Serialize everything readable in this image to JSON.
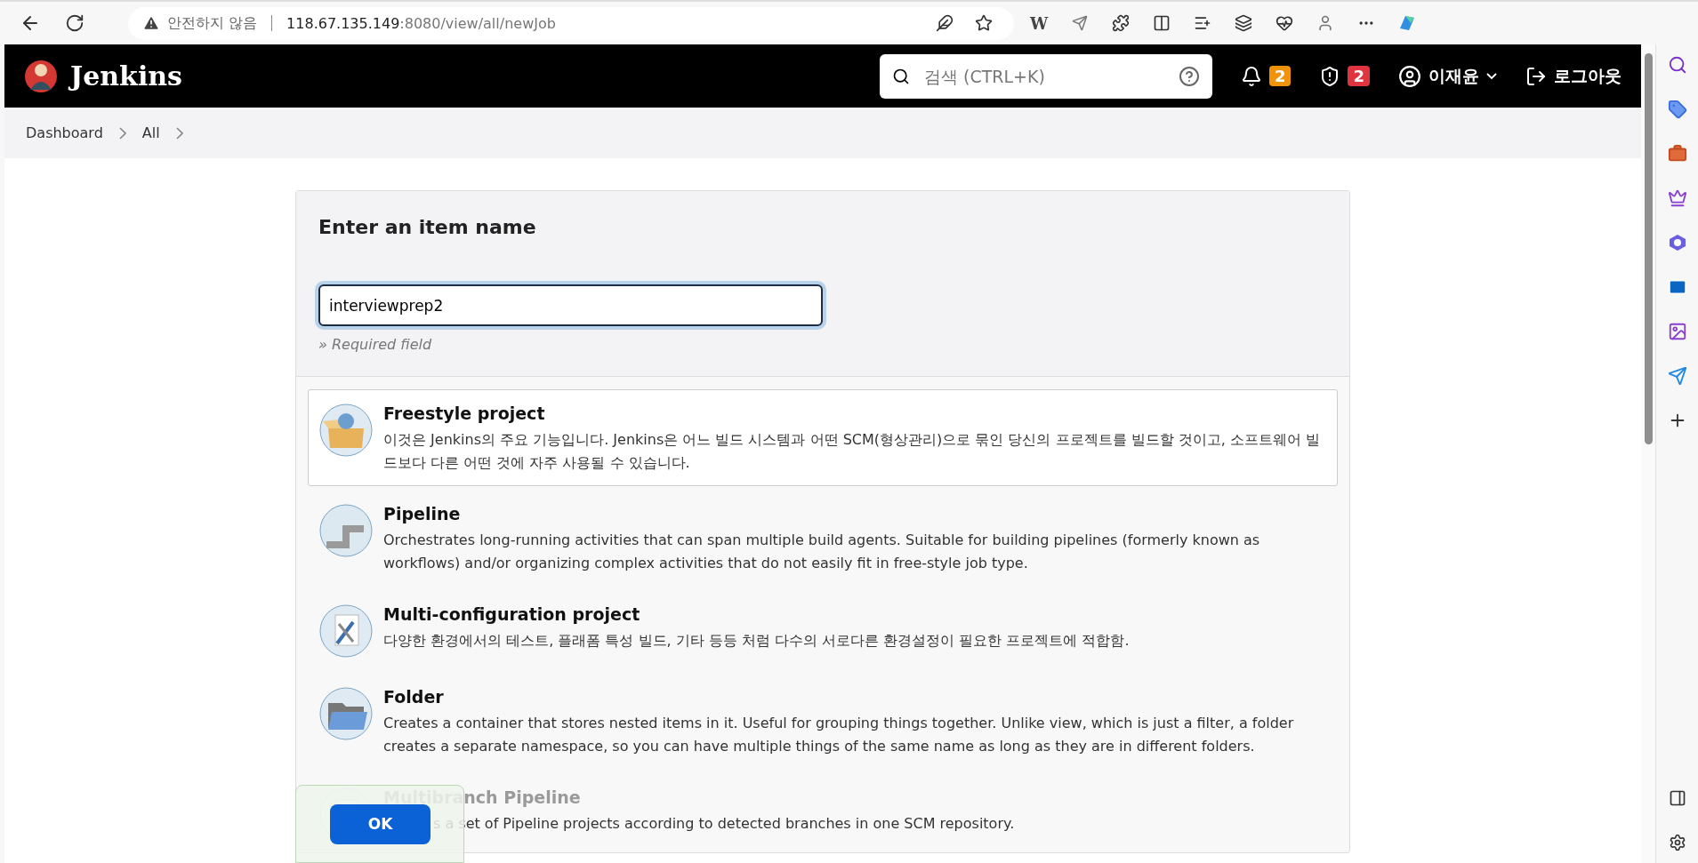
{
  "browser": {
    "security_label": "안전하지 않음",
    "url_host": "118.67.135.149",
    "url_path": ":8080/view/all/newJob",
    "extension_label": "W"
  },
  "header": {
    "brand": "Jenkins",
    "search": {
      "placeholder": "검색 (CTRL+K)"
    },
    "notifications": {
      "count": "2"
    },
    "security": {
      "count": "2"
    },
    "user": {
      "name": "이재윤"
    },
    "logout": "로그아웃"
  },
  "breadcrumb": [
    "Dashboard",
    "All"
  ],
  "form": {
    "title": "Enter an item name",
    "name_field": {
      "value": "interviewprep2"
    },
    "hint": "» Required field"
  },
  "item_types": [
    {
      "kind": "box",
      "name": "Freestyle project",
      "description": "이것은 Jenkins의 주요 기능입니다. Jenkins은 어느 빌드 시스템과 어떤 SCM(형상관리)으로 묶인 당신의 프로젝트를 빌드할 것이고, 소프트웨어 빌드보다 다른 어떤 것에 자주 사용될 수 있습니다.",
      "selected": true,
      "covered": false
    },
    {
      "kind": "pipe",
      "name": "Pipeline",
      "description": "Orchestrates long-running activities that can span multiple build agents. Suitable for building pipelines (formerly known as workflows) and/or organizing complex activities that do not easily fit in free-style job type.",
      "selected": false,
      "covered": false
    },
    {
      "kind": "config",
      "name": "Multi-configuration project",
      "description": "다양한 환경에서의 테스트, 플래폼 특성 빌드, 기타 등등 처럼 다수의 서로다른 환경설정이 필요한 프로젝트에 적합함.",
      "selected": false,
      "covered": false
    },
    {
      "kind": "folder",
      "name": "Folder",
      "description": "Creates a container that stores nested items in it. Useful for grouping things together. Unlike view, which is just a filter, a folder creates a separate namespace, so you can have multiple things of the same name as long as they are in different folders.",
      "selected": false,
      "covered": false
    },
    {
      "kind": "multibranch",
      "name": "Multibranch Pipeline",
      "description": "s a set of Pipeline projects according to detected branches in one SCM repository.",
      "selected": false,
      "covered": true
    }
  ],
  "ok_button": "OK"
}
